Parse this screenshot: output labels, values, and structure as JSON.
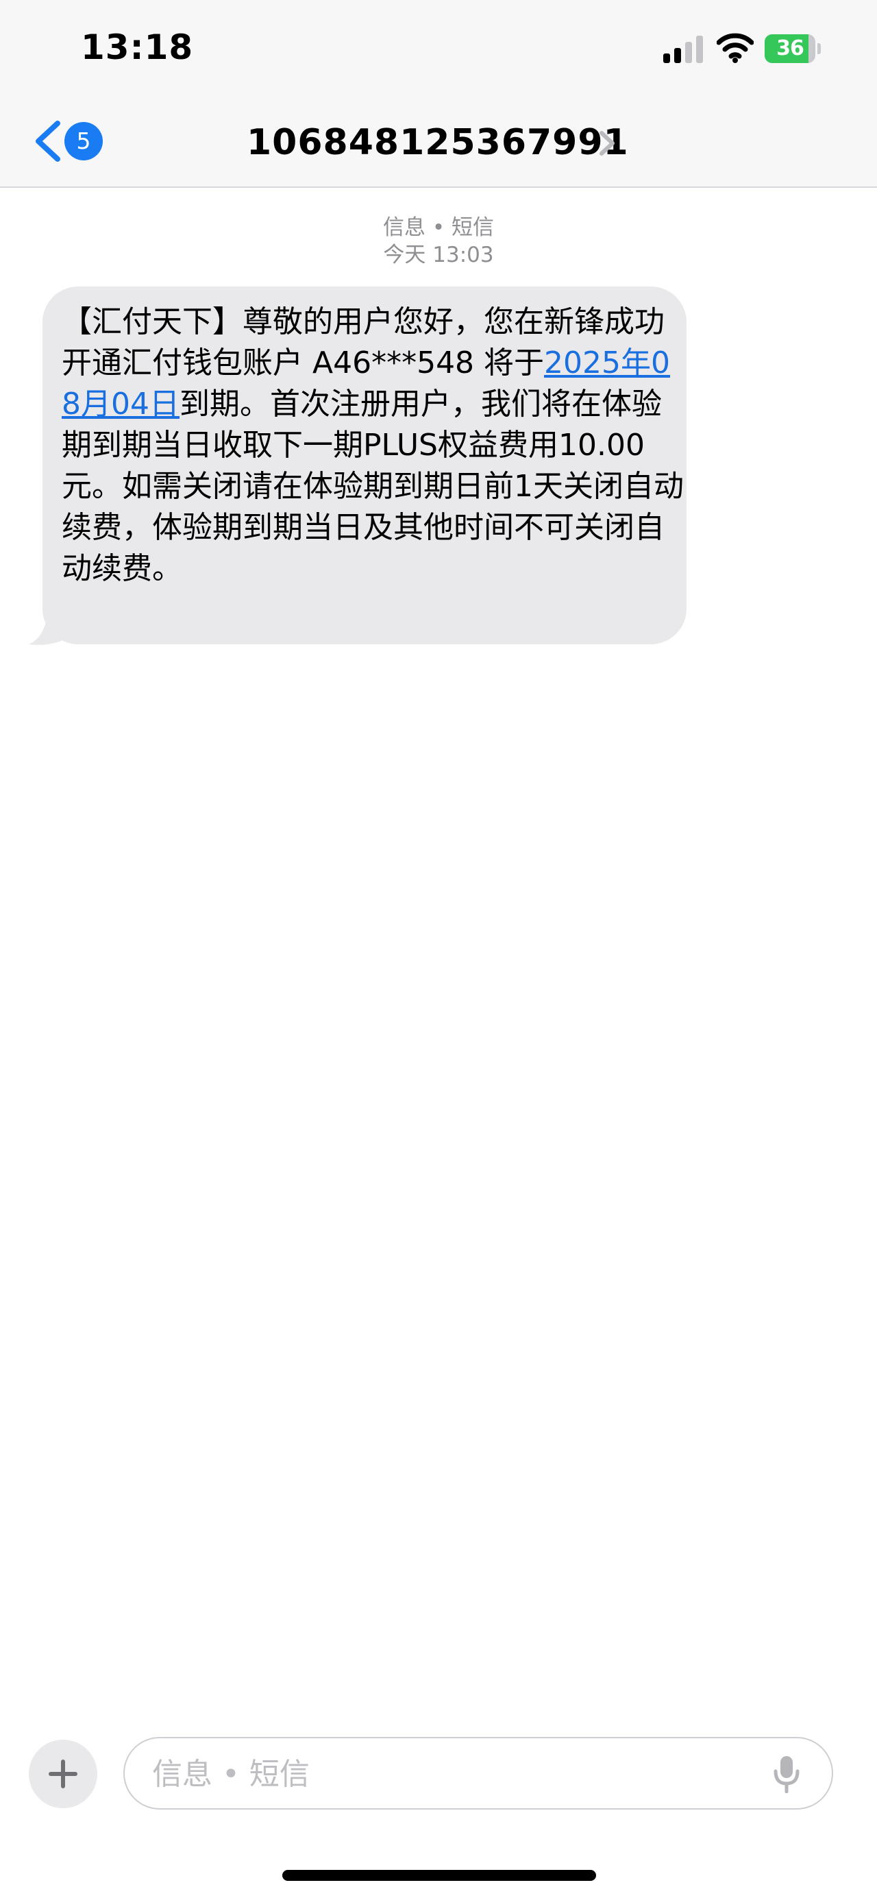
{
  "status_bar": {
    "time": "13:18",
    "battery_level": "36",
    "battery_fraction": 0.36,
    "battery_color": "#35c759",
    "icons": [
      "signal-icon",
      "wifi-icon",
      "battery-icon"
    ]
  },
  "nav": {
    "back_badge": "5",
    "contact": "106848125367991",
    "icons": [
      "chevron-left-icon",
      "chevron-right-icon"
    ],
    "accent_color": "#1a7cf3"
  },
  "conversation": {
    "service_label": "信息 • 短信",
    "timestamp": "今天 13:03",
    "message": {
      "text_before": "【汇付天下】尊敬的用户您好，您在新锋成功开通汇付钱包账户 A46***548 将于",
      "date_link": "2025年08月04日",
      "text_after": "到期。首次注册用户，我们将在体验期到期当日收取下一期PLUS权益费用10.00元。如需关闭请在体验期到期日前1天关闭自动续费，体验期到期当日及其他时间不可关闭自动续费。"
    }
  },
  "compose": {
    "placeholder": "信息 • 短信",
    "icons": [
      "plus-icon",
      "microphone-icon"
    ]
  }
}
